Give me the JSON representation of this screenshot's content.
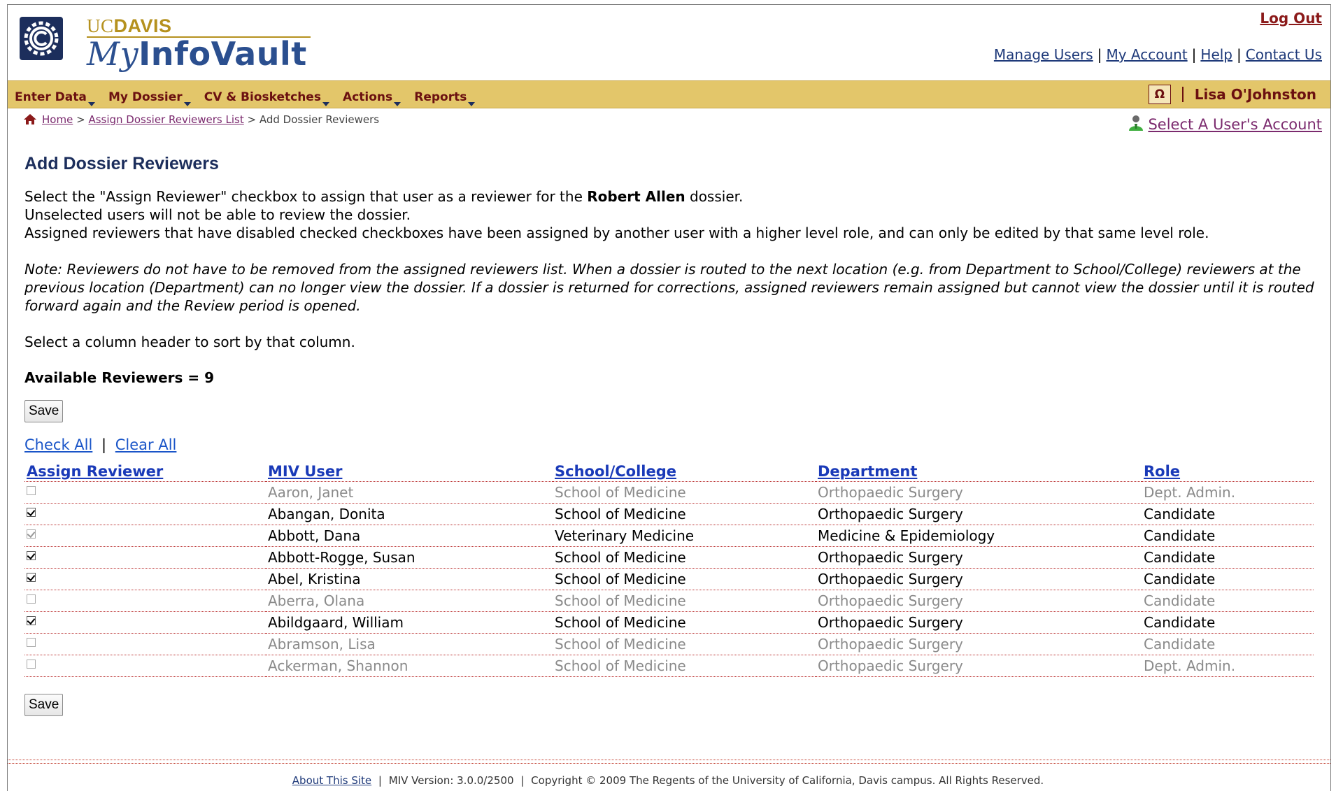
{
  "header": {
    "logo_uc": "UC",
    "logo_davis": "DAVIS",
    "logo_my": "My",
    "logo_infovault": "InfoVault",
    "logout": "Log Out",
    "links": [
      "Manage Users",
      "My Account",
      "Help",
      "Contact Us"
    ]
  },
  "nav": {
    "items": [
      "Enter Data",
      "My Dossier",
      "CV & Biosketches",
      "Actions",
      "Reports"
    ],
    "omega": "Ω",
    "username": "Lisa O'Johnston"
  },
  "breadcrumb": {
    "home": "Home",
    "list": "Assign Dossier Reviewers List",
    "current": "Add Dossier Reviewers",
    "sep": ">"
  },
  "select_account": "Select A User's Account",
  "page": {
    "title": "Add Dossier Reviewers",
    "intro_before": "Select the \"Assign Reviewer\" checkbox to assign that user as a reviewer for the ",
    "intro_name": "Robert Allen",
    "intro_after": " dossier.",
    "line2": "Unselected users will not be able to review the dossier.",
    "line3": "Assigned reviewers that have disabled checked checkboxes have been assigned by another user with a higher level role, and can only be edited by that same level role.",
    "note": "Note: Reviewers do not have to be removed from the assigned reviewers list. When a dossier is routed to the next location (e.g. from Department to School/College) reviewers at the previous location (Department) can no longer view the dossier. If a dossier is returned for corrections, assigned reviewers remain assigned but cannot view the dossier until it is routed forward again and the Review period is opened.",
    "sort_hint": "Select a column header to sort by that column.",
    "available": "Available Reviewers = 9",
    "save": "Save",
    "check_all": "Check All",
    "clear_all": "Clear All",
    "pipe": "|"
  },
  "table": {
    "headers": [
      "Assign Reviewer",
      "MIV User",
      "School/College",
      "Department",
      "Role"
    ],
    "rows": [
      {
        "checked": false,
        "disabled": true,
        "user": "Aaron, Janet",
        "school": "School of Medicine",
        "dept": "Orthopaedic Surgery",
        "role": "Dept. Admin."
      },
      {
        "checked": true,
        "disabled": false,
        "user": "Abangan, Donita",
        "school": "School of Medicine",
        "dept": "Orthopaedic Surgery",
        "role": "Candidate"
      },
      {
        "checked": true,
        "disabled": true,
        "grayText": false,
        "user": "Abbott, Dana",
        "school": "Veterinary Medicine",
        "dept": "Medicine & Epidemiology",
        "role": "Candidate"
      },
      {
        "checked": true,
        "disabled": false,
        "user": "Abbott-Rogge, Susan",
        "school": "School of Medicine",
        "dept": "Orthopaedic Surgery",
        "role": "Candidate"
      },
      {
        "checked": true,
        "disabled": false,
        "user": "Abel, Kristina",
        "school": "School of Medicine",
        "dept": "Orthopaedic Surgery",
        "role": "Candidate"
      },
      {
        "checked": false,
        "disabled": true,
        "user": "Aberra, Olana",
        "school": "School of Medicine",
        "dept": "Orthopaedic Surgery",
        "role": "Candidate"
      },
      {
        "checked": true,
        "disabled": false,
        "user": "Abildgaard, William",
        "school": "School of Medicine",
        "dept": "Orthopaedic Surgery",
        "role": "Candidate"
      },
      {
        "checked": false,
        "disabled": true,
        "user": "Abramson, Lisa",
        "school": "School of Medicine",
        "dept": "Orthopaedic Surgery",
        "role": "Candidate"
      },
      {
        "checked": false,
        "disabled": true,
        "user": "Ackerman, Shannon",
        "school": "School of Medicine",
        "dept": "Orthopaedic Surgery",
        "role": "Dept. Admin."
      }
    ]
  },
  "footer": {
    "about": "About This Site",
    "version": "MIV Version: 3.0.0/2500",
    "copyright": "Copyright © 2009 The Regents of the University of California, Davis campus. All Rights Reserved.",
    "sep": "|"
  },
  "colors": {
    "navbar": "#e3c66a",
    "brand_blue": "#2b4f8f",
    "brand_gold": "#b5911e",
    "nav_text": "#6b1010"
  }
}
